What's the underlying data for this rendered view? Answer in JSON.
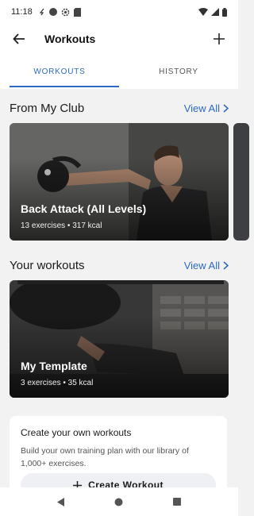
{
  "status": {
    "time": "11:18"
  },
  "header": {
    "title": "Workouts"
  },
  "tabs": [
    {
      "label": "WORKOUTS"
    },
    {
      "label": "HISTORY"
    }
  ],
  "club": {
    "title": "From My Club",
    "view_all": "View All",
    "card": {
      "title": "Back Attack (All Levels)",
      "subtitle": "13 exercises • 317 kcal"
    }
  },
  "yours": {
    "title": "Your workouts",
    "view_all": "View All",
    "card": {
      "title": "My Template",
      "subtitle": "3 exercises • 35 kcal"
    }
  },
  "create": {
    "title": "Create your own workouts",
    "description": "Build your own training plan with our library of 1,000+ exercises.",
    "button": "Create Workout"
  },
  "colors": {
    "accent": "#2c6ac4",
    "background": "#f2f2f2"
  }
}
